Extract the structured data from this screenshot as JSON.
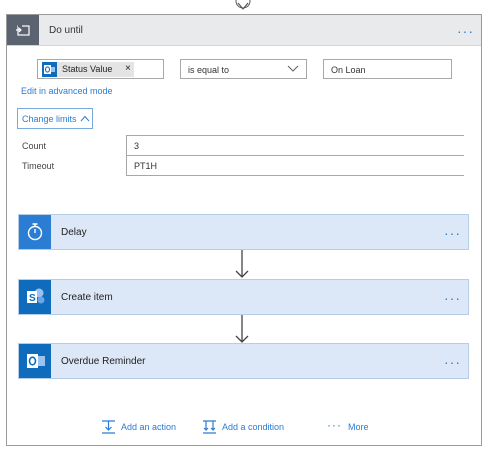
{
  "loop": {
    "title": "Do until",
    "condition": {
      "token_label": "Status Value",
      "token_remove": "×",
      "operator": "is equal to",
      "value": "On Loan"
    },
    "advanced_mode_link": "Edit in advanced mode",
    "change_limits_label": "Change limits",
    "limits": [
      {
        "label": "Count",
        "value": "3"
      },
      {
        "label": "Timeout",
        "value": "PT1H"
      }
    ]
  },
  "actions": [
    {
      "label": "Delay",
      "icon": "timer-icon",
      "icon_bg": "#2b7cd3"
    },
    {
      "label": "Create item",
      "icon": "sharepoint-icon",
      "icon_bg": "#0f6cbd"
    },
    {
      "label": "Overdue Reminder",
      "icon": "outlook-icon",
      "icon_bg": "#0f6cbd"
    }
  ],
  "footer": {
    "add_action": "Add an action",
    "add_condition": "Add a condition",
    "more": "More"
  },
  "colors": {
    "accent": "#2b7cd3",
    "header_bg": "#e9eaec",
    "header_icon_bg": "#5b6270",
    "action_bg": "#dce8f7"
  }
}
